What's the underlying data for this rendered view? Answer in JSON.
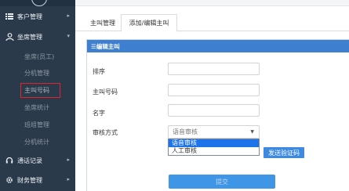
{
  "sidebar": {
    "items": [
      {
        "label": "客户管理",
        "icon": "list-icon"
      },
      {
        "label": "坐席管理",
        "icon": "users-icon"
      },
      {
        "label": "通话记录",
        "icon": "headset-icon"
      },
      {
        "label": "财务管理",
        "icon": "settings-icon"
      }
    ],
    "sub_items": [
      {
        "label": "坐席(员工)"
      },
      {
        "label": "分机管理"
      },
      {
        "label": "主叫号码"
      },
      {
        "label": "坐席统计"
      },
      {
        "label": "班组管理"
      },
      {
        "label": "分机统计"
      }
    ]
  },
  "tabs": [
    {
      "label": "主叫管理"
    },
    {
      "label": "添加/编辑主叫"
    }
  ],
  "panel": {
    "title": "☰编辑主叫",
    "fields": [
      {
        "label": "排序",
        "value": ""
      },
      {
        "label": "主叫号码",
        "value": ""
      },
      {
        "label": "名字",
        "value": ""
      }
    ],
    "review": {
      "label": "审核方式",
      "selected": "语音审核",
      "options": [
        "语音审核",
        "人工审核"
      ]
    },
    "sms_button": "发送验证码",
    "submit_button": "提交"
  }
}
